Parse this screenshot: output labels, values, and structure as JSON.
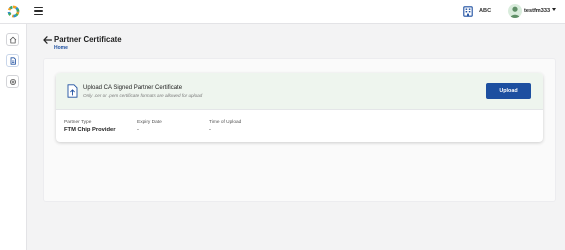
{
  "header": {
    "org_name": "ABC",
    "user_name": "testfm333"
  },
  "page": {
    "title": "Partner Certificate",
    "breadcrumb": "Home"
  },
  "upload": {
    "title": "Upload CA Signed Partner Certificate",
    "hint": "Only .cer or .pem certificate formats are allowed for upload",
    "button_label": "Upload"
  },
  "details": {
    "partner_type_label": "Partner Type",
    "partner_type_value": "FTM Chip Provider",
    "expiry_label": "Expiry Date",
    "expiry_value": "-",
    "upload_time_label": "Time of Upload",
    "upload_time_value": "-"
  },
  "colors": {
    "primary": "#1d4fa0",
    "upload_banner": "#eef5ee"
  },
  "icons": {
    "logo": "app-logo-icon",
    "menu": "hamburger-menu-icon",
    "org": "building-icon",
    "avatar": "user-avatar",
    "caret": "caret-down-icon",
    "sidebar": [
      "home-icon",
      "document-icon",
      "settings-icon"
    ],
    "back": "arrow-left-icon",
    "file_upload": "file-upload-icon"
  }
}
